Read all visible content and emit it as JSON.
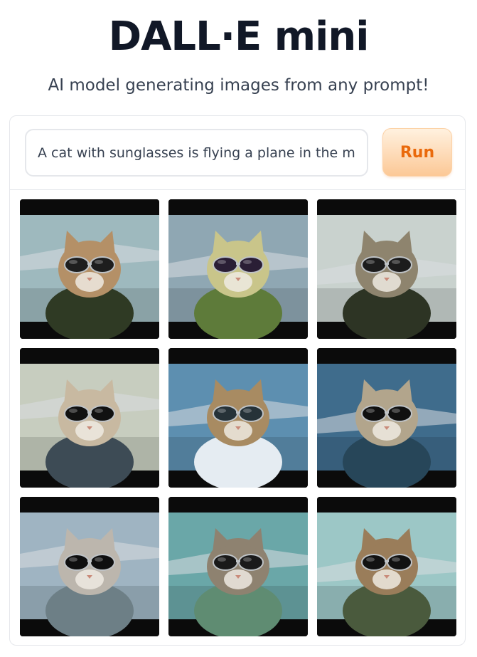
{
  "header": {
    "title": "DALL·E mini",
    "subtitle": "AI model generating images from any prompt!"
  },
  "prompt": {
    "value": "A cat with sunglasses is flying a plane in the movie Top Gun",
    "placeholder": ""
  },
  "run_button": {
    "label": "Run"
  },
  "colors": {
    "accent_text": "#ea6a0c",
    "accent_bg": "#fcc896",
    "title": "#111827"
  },
  "gallery": {
    "images": [
      {
        "id": "cat-cockpit-side",
        "sky": "#9eb9be",
        "fur": "#b49067",
        "glasses": "#1e1e1e",
        "jacket": "#2f3a24"
      },
      {
        "id": "cat-closeup-red-glasses",
        "sky": "#8fa7b3",
        "fur": "#c9c58a",
        "glasses": "#2a1e35",
        "jacket": "#5e7b3a"
      },
      {
        "id": "cat-on-wing",
        "sky": "#c9d2ce",
        "fur": "#8e846e",
        "glasses": "#1c1c1c",
        "jacket": "#2d3424"
      },
      {
        "id": "cat-under-jet",
        "sky": "#c7cdbf",
        "fur": "#c8b9a1",
        "glasses": "#111111",
        "jacket": "#3d4b55"
      },
      {
        "id": "cat-flying-clouds",
        "sky": "#5d8fb0",
        "fur": "#a88b62",
        "glasses": "#263238",
        "jacket": "#e5ecf2"
      },
      {
        "id": "cat-blue-jet",
        "sky": "#3f6c8c",
        "fur": "#b2a58c",
        "glasses": "#101010",
        "jacket": "#274659"
      },
      {
        "id": "cat-standing-sea",
        "sky": "#9fb4c2",
        "fur": "#bcb6ad",
        "glasses": "#0f0f0f",
        "jacket": "#6d7f86"
      },
      {
        "id": "cat-helmet-cockpit",
        "sky": "#6aa7a8",
        "fur": "#8e8270",
        "glasses": "#1a1a1a",
        "jacket": "#5f8c72"
      },
      {
        "id": "cat-pilot-cap",
        "sky": "#9cc7c6",
        "fur": "#9a7d5a",
        "glasses": "#121212",
        "jacket": "#4a5a3d"
      }
    ]
  }
}
